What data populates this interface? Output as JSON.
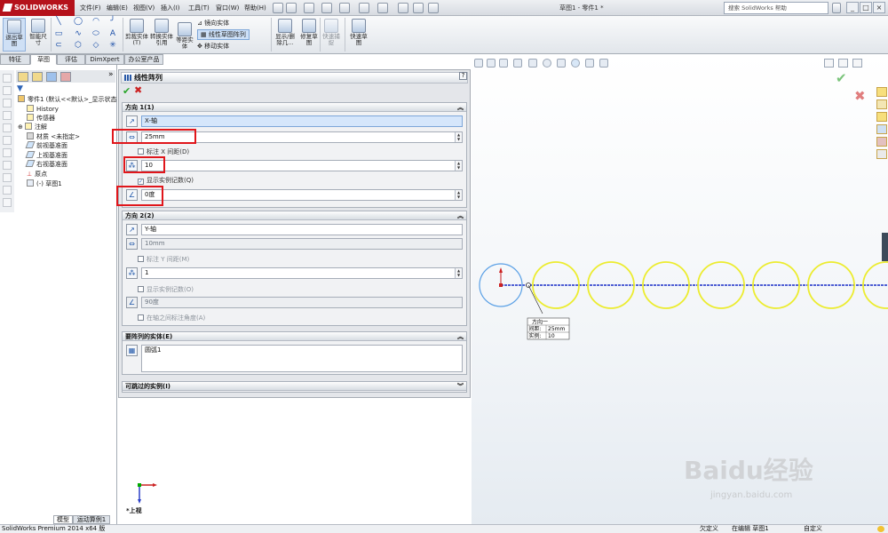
{
  "app": {
    "logo_text": "SOLIDWORKS",
    "menus": [
      "文件(F)",
      "编辑(E)",
      "视图(V)",
      "插入(I)",
      "工具(T)",
      "窗口(W)",
      "帮助(H)"
    ],
    "doc_title": "草图1 - 零件1 *",
    "search_placeholder": "搜索 SolidWorks 帮助",
    "win_controls": [
      "_",
      "□",
      "×"
    ],
    "tabs": [
      "特征",
      "草图",
      "评估",
      "DimXpert",
      "办公室产品"
    ],
    "active_tab": "草图"
  },
  "commandbar": {
    "exit_sketch": "退出草图",
    "smart_dim": "智能尺寸",
    "trim": "剪裁实体(T)",
    "convert": "转换实体引用",
    "offset": "等距实体",
    "mirror": "镜向实体",
    "linear_pattern": "线性草图阵列",
    "move": "移动实体",
    "display_delete": "显示/删除几...",
    "repair": "修复草图",
    "quick_snaps": "快速捕捉",
    "rapid_sketch": "快速草图"
  },
  "tree": {
    "root": "零件1 (默认<<默认>_显示状态",
    "items": [
      "History",
      "传感器",
      "注解",
      "材质 <未指定>",
      "前视基准面",
      "上视基准面",
      "右视基准面",
      "原点",
      "(-) 草图1"
    ],
    "bottom_tabs": [
      "模型",
      "运动算例1"
    ]
  },
  "property_manager": {
    "title": "线性阵列",
    "help": "?",
    "ok": "✔",
    "cancel": "✖",
    "dir1": {
      "title": "方向 1(1)",
      "axis": "X-轴",
      "spacing": "25mm",
      "dim_spacing_label": "标注 X 间距(D)",
      "count": "10",
      "display_count_label": "显示实例记数(Q)",
      "angle": "0度"
    },
    "dir2": {
      "title": "方向 2(2)",
      "axis": "Y-轴",
      "spacing": "10mm",
      "dim_spacing_label": "标注 Y 间距(M)",
      "count": "1",
      "display_count_label": "显示实例记数(O)",
      "angle": "90度",
      "fix_angle_label": "在轴之间标注角度(A)"
    },
    "entities": {
      "title": "要阵列的实体(E)",
      "item": "圆弧1"
    },
    "skip": {
      "title": "可跳过的实例(I)"
    }
  },
  "graphics": {
    "view_label": "*上视",
    "callout": {
      "title": "方向一",
      "spacing_label": "间距:",
      "spacing_value": "25mm",
      "count_label": "实例:",
      "count_value": "10"
    },
    "watermark": "Baidu经验",
    "watermark_url": "jingyan.baidu.com",
    "circle_color": "#ecec2f",
    "selected_circle_color": "#5aa0e6",
    "axis_color": "#1a2fc8"
  },
  "status": {
    "product": "SolidWorks Premium 2014 x64 版",
    "state1": "欠定义",
    "state2": "在编辑 草图1",
    "state3": "自定义"
  }
}
